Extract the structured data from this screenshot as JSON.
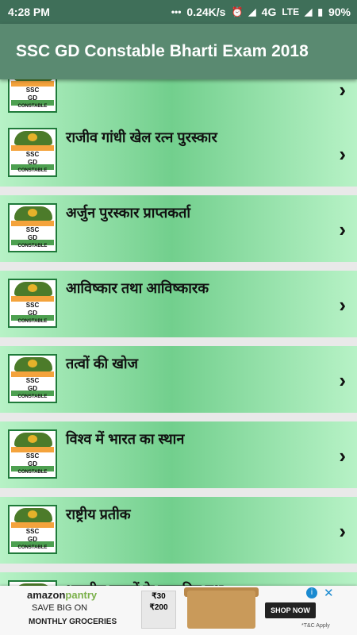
{
  "status": {
    "time": "4:28 PM",
    "speed": "0.24K/s",
    "network": "4G",
    "volte": "VoLTE",
    "battery": "90%"
  },
  "toolbar": {
    "title": "SSC GD Constable Bharti Exam 2018"
  },
  "thumb": {
    "line1": "SSC",
    "line2": "GD",
    "line3": "CONSTABLE"
  },
  "items": [
    {
      "label": ""
    },
    {
      "label": "राजीव गांधी खेल रत्न पुरस्कार"
    },
    {
      "label": "अर्जुन पुरस्कार प्राप्तकर्ता"
    },
    {
      "label": "आविष्कार तथा आविष्कारक"
    },
    {
      "label": "तत्वों की खोज"
    },
    {
      "label": "विश्व में भारत का स्थान"
    },
    {
      "label": "राष्ट्रीय प्रतीक"
    },
    {
      "label": "भारतीय राज्यों के राजकीय पशु"
    }
  ],
  "ad": {
    "brand_main": "amazon",
    "brand_sub": "pantry",
    "save_text": "SAVE BIG ON",
    "monthly_text": "MONTHLY GROCERIES",
    "offer_top": "₹30",
    "offer_bottom": "₹200",
    "cta": "SHOP NOW",
    "terms": "*T&C Apply"
  }
}
